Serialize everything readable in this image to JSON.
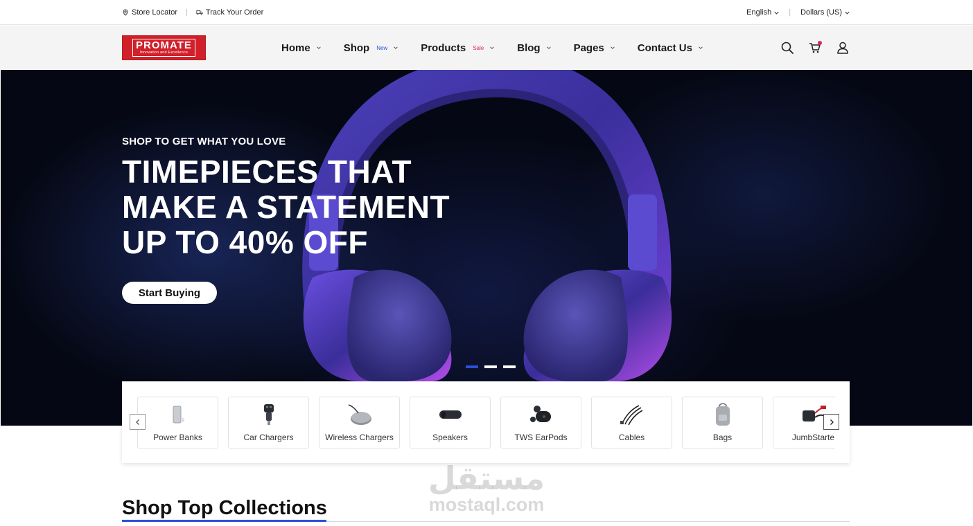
{
  "topbar": {
    "store_locator": "Store Locator",
    "track_order": "Track Your Order",
    "language": "English",
    "currency": "Dollars (US)"
  },
  "header": {
    "logo_main": "PROMATE",
    "logo_tagline": "Innovation and Excellence",
    "nav": [
      {
        "label": "Home",
        "badge": ""
      },
      {
        "label": "Shop",
        "badge": "New"
      },
      {
        "label": "Products",
        "badge": "Sale"
      },
      {
        "label": "Blog",
        "badge": ""
      },
      {
        "label": "Pages",
        "badge": ""
      },
      {
        "label": "Contact Us",
        "badge": ""
      }
    ],
    "icons": [
      "search-icon",
      "cart-icon",
      "user-icon"
    ]
  },
  "hero": {
    "eyebrow": "SHOP TO GET WHAT YOU LOVE",
    "title_lines": [
      "TIMEPIECES THAT",
      "MAKE A STATEMENT",
      "UP TO 40% OFF"
    ],
    "cta": "Start Buying",
    "slides": 3,
    "active_slide": 1
  },
  "categories": [
    {
      "label": "Power Banks",
      "icon": "power-bank-icon"
    },
    {
      "label": "Car Chargers",
      "icon": "car-charger-icon"
    },
    {
      "label": "Wireless Chargers",
      "icon": "wireless-charger-icon"
    },
    {
      "label": "Speakers",
      "icon": "speaker-icon"
    },
    {
      "label": "TWS EarPods",
      "icon": "earpods-icon"
    },
    {
      "label": "Cables",
      "icon": "cable-icon"
    },
    {
      "label": "Bags",
      "icon": "bag-icon"
    },
    {
      "label": "JumbStarte",
      "icon": "jump-starter-icon"
    }
  ],
  "section": {
    "title": "Shop Top Collections"
  },
  "watermark": {
    "arabic": "مستقل",
    "latin": "mostaql.com"
  },
  "colors": {
    "brand_red": "#d0202a",
    "accent_blue": "#2b4fd9",
    "sale_pink": "#e0245e"
  }
}
